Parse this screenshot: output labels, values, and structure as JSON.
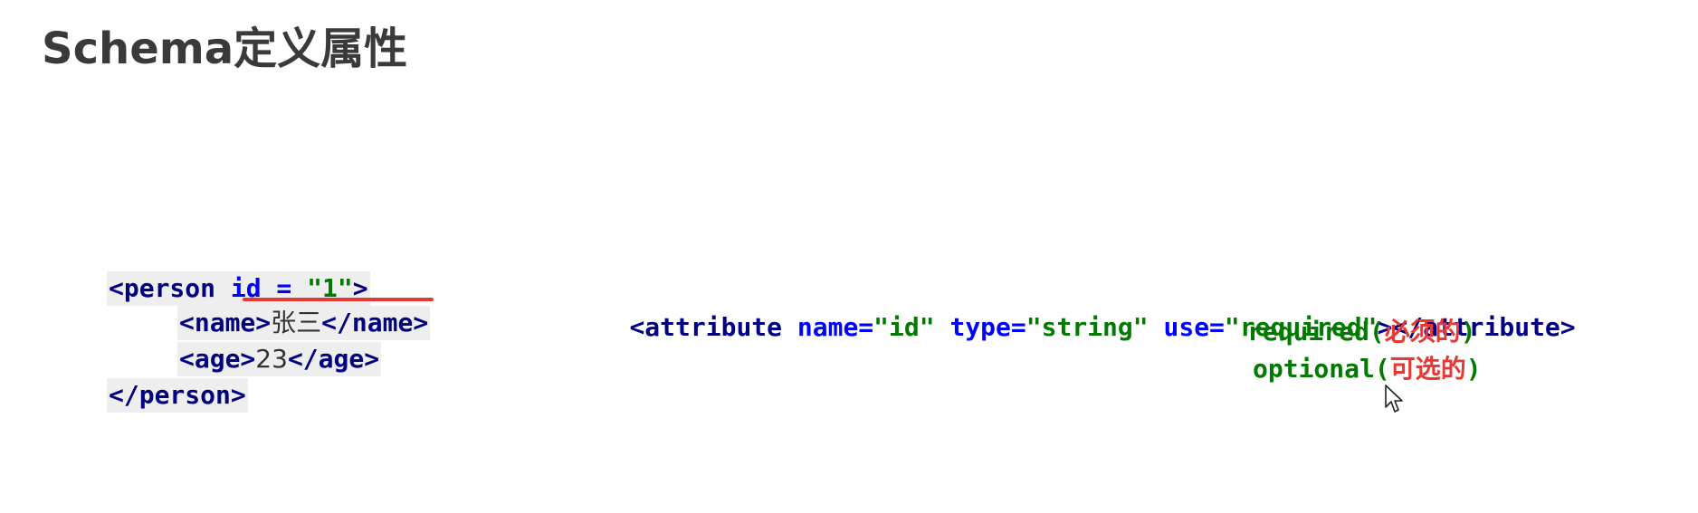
{
  "slide": {
    "title": "Schema定义属性"
  },
  "xml_example": {
    "line1": {
      "open": "<person ",
      "attr_name": "id = ",
      "attr_value": "\"1\"",
      "close": ">"
    },
    "line2": {
      "open_tag": "<name>",
      "text": "张三",
      "close_tag": "</name>"
    },
    "line3": {
      "open_tag": "<age>",
      "text": "23",
      "close_tag": "</age>"
    },
    "line4": {
      "close_tag": "</person>"
    },
    "highlight_color": "#e53935"
  },
  "attribute_definition": {
    "open": "<attribute ",
    "name_attr": "name=",
    "name_value": "\"id\"",
    "type_attr": " type=",
    "type_value": "\"string\"",
    "use_attr": " use=",
    "use_value": "\"required\"",
    "close": "></attribute>"
  },
  "use_options": [
    {
      "value": "required",
      "open_paren": "(",
      "note": "必须的",
      "close_paren": ")"
    },
    {
      "value": "optional",
      "open_paren": "(",
      "note": "可选的",
      "close_paren": ")"
    }
  ],
  "colors": {
    "tag": "#000080",
    "attribute": "#0000ff",
    "value": "#007a00",
    "note": "#e53935",
    "title": "#3a3a3a"
  },
  "icons": {
    "cursor": "mouse-pointer-icon"
  }
}
